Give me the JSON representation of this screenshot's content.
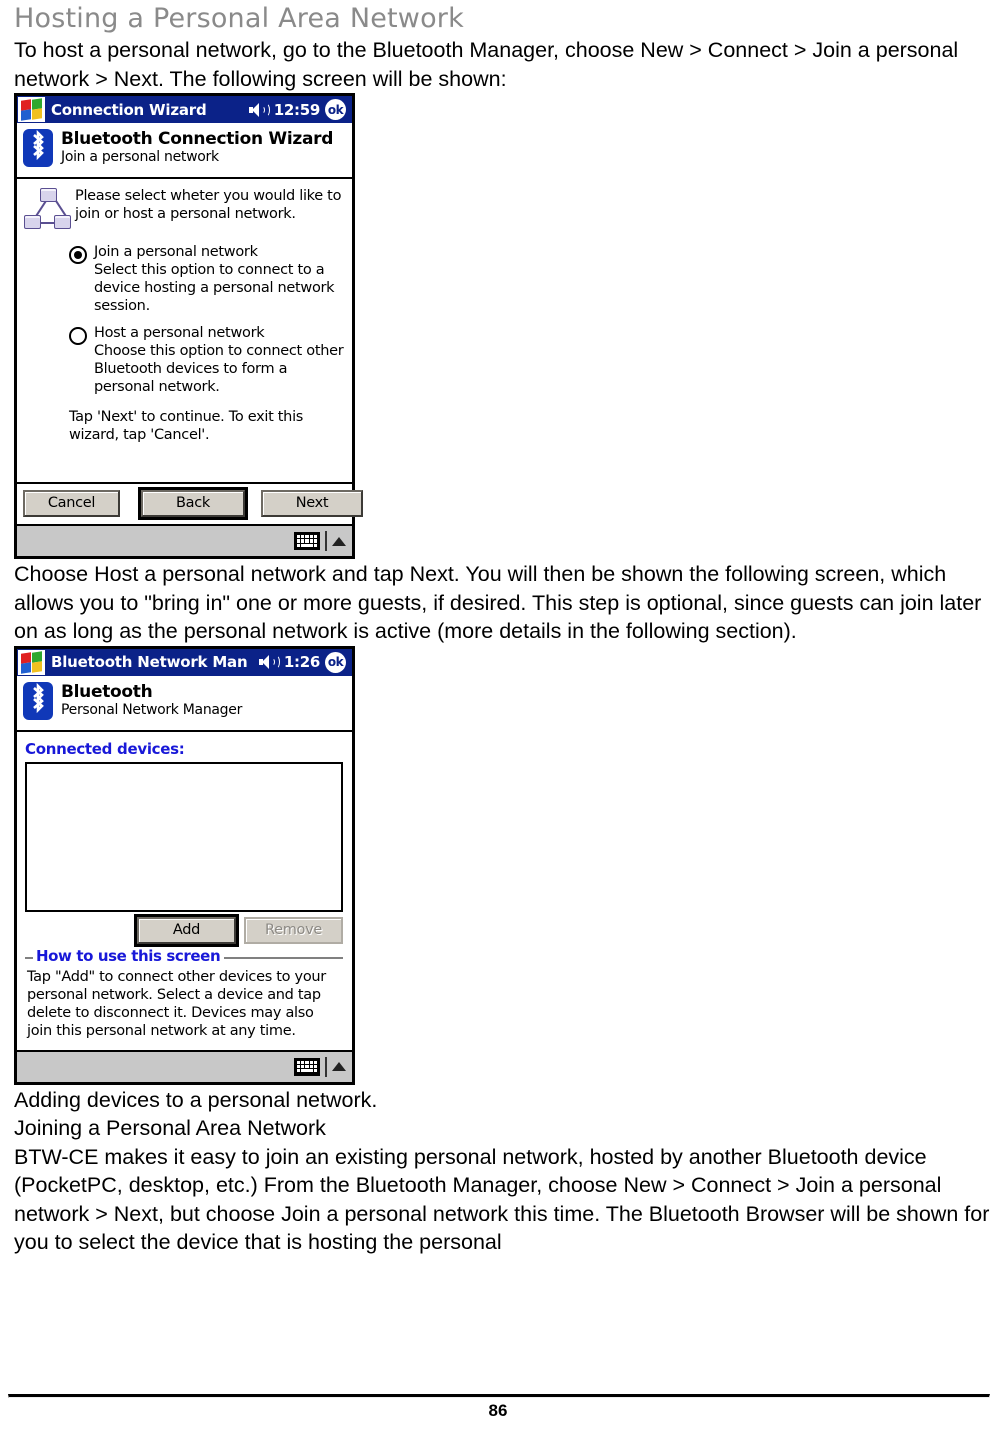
{
  "heading": "Hosting a Personal Area Network",
  "paragraphs": {
    "intro": "To host a personal network, go to the Bluetooth Manager, choose New > Connect > Join a personal network > Next. The following screen will be shown:",
    "after_wizard": "Choose Host a personal network and tap Next. You will then be shown the following screen, which allows you to \"bring in\" one or more guests, if desired. This step is optional, since guests can join later on as long as the personal network is active (more details in the following section).",
    "caption_adding": "Adding devices to a personal network.",
    "subheading_joining": "Joining a Personal Area Network",
    "joining_body": "BTW-CE makes it easy to join an existing personal network, hosted by another Bluetooth device (PocketPC, desktop, etc.) From the Bluetooth Manager, choose New > Connect > Join a personal network > Next, but choose Join a personal network this time. The Bluetooth Browser will be shown for you to select the device that is hosting the personal"
  },
  "screenshot_wizard": {
    "titlebar": {
      "start_icon": "windows-logo-icon",
      "title": "Connection Wizard",
      "volume_icon": "speaker-icon",
      "clock": "12:59",
      "ok_label": "ok"
    },
    "banner": {
      "logo_icon": "bluetooth-logo-icon",
      "title": "Bluetooth Connection Wizard",
      "subtitle": "Join a personal network"
    },
    "intro_icon": "personal-network-icon",
    "intro_text": "Please select wheter you would like to join or host a personal network.",
    "options": [
      {
        "title": "Join a personal network",
        "description": "Select this option to connect to a device hosting a personal network session.",
        "selected": true
      },
      {
        "title": "Host a personal network",
        "description": "Choose this option to connect other Bluetooth devices to form a personal network.",
        "selected": false
      }
    ],
    "note": "Tap 'Next' to continue. To exit this wizard, tap 'Cancel'.",
    "buttons": {
      "cancel": "Cancel",
      "back": "Back",
      "next": "Next"
    },
    "taskbar": {
      "keyboard_icon": "keyboard-icon",
      "arrow_icon": "chevron-up-icon"
    }
  },
  "screenshot_pnm": {
    "titlebar": {
      "start_icon": "windows-logo-icon",
      "title": "Bluetooth Network Man",
      "volume_icon": "speaker-icon",
      "clock": "1:26",
      "ok_label": "ok"
    },
    "banner": {
      "logo_icon": "bluetooth-logo-icon",
      "title": "Bluetooth",
      "subtitle": "Personal Network Manager"
    },
    "list_label": "Connected devices:",
    "list_items": [],
    "buttons": {
      "add": "Add",
      "remove": "Remove"
    },
    "help": {
      "title": "How to use this screen",
      "body": "Tap \"Add\" to connect other devices to your personal network. Select a device and tap delete to disconnect it. Devices may also join this personal network at any time."
    },
    "taskbar": {
      "keyboard_icon": "keyboard-icon",
      "arrow_icon": "chevron-up-icon"
    }
  },
  "footer": {
    "page_number": "86"
  },
  "colors": {
    "heading_gray": "#8a8a8a",
    "titlebar_blue": "#0b2288",
    "label_blue": "#1818d8",
    "bluetooth_blue": "#1038b8",
    "button_face": "#d4d0c8",
    "taskbar_gray": "#c8c8c8"
  }
}
